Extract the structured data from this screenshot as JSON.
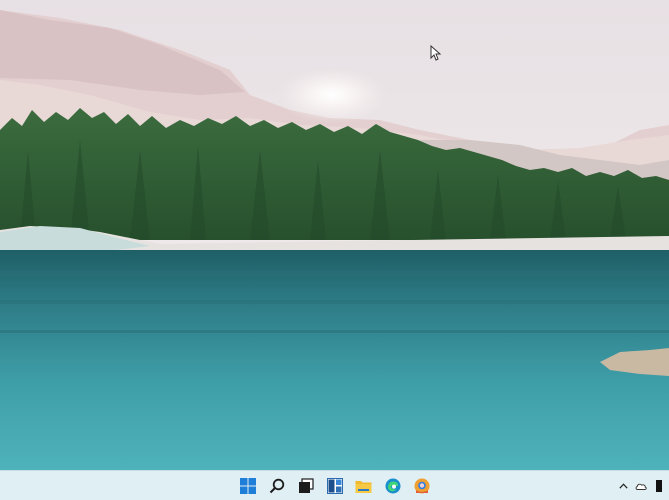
{
  "desktop": {
    "wallpaper": "lakeside-forest-with-snowy-hills",
    "colors": {
      "sky": "#e9e3e6",
      "water": "#3f9ea8",
      "forest": "#2f5c35",
      "taskbar": "#dfeff4"
    }
  },
  "taskbar": {
    "pinned_apps": [
      {
        "name": "start",
        "icon": "windows-logo-icon",
        "color": "#1f7ed8"
      },
      {
        "name": "search",
        "icon": "search-icon",
        "color": "#1c1c1c"
      },
      {
        "name": "task-view",
        "icon": "task-view-icon",
        "color": "#1c1c1c"
      },
      {
        "name": "widgets",
        "icon": "widgets-icon",
        "color": "#2b6cb0"
      },
      {
        "name": "file-explorer",
        "icon": "folder-icon",
        "color": "#f2b92b"
      },
      {
        "name": "edge",
        "icon": "edge-browser-icon",
        "color": "#1a8fce"
      },
      {
        "name": "chrome-canary",
        "icon": "browser-app-icon",
        "color": "#f0a030"
      }
    ],
    "tray": {
      "icons": [
        "chevron-up-icon",
        "onedrive-cloud-icon",
        "network-icon"
      ]
    }
  }
}
